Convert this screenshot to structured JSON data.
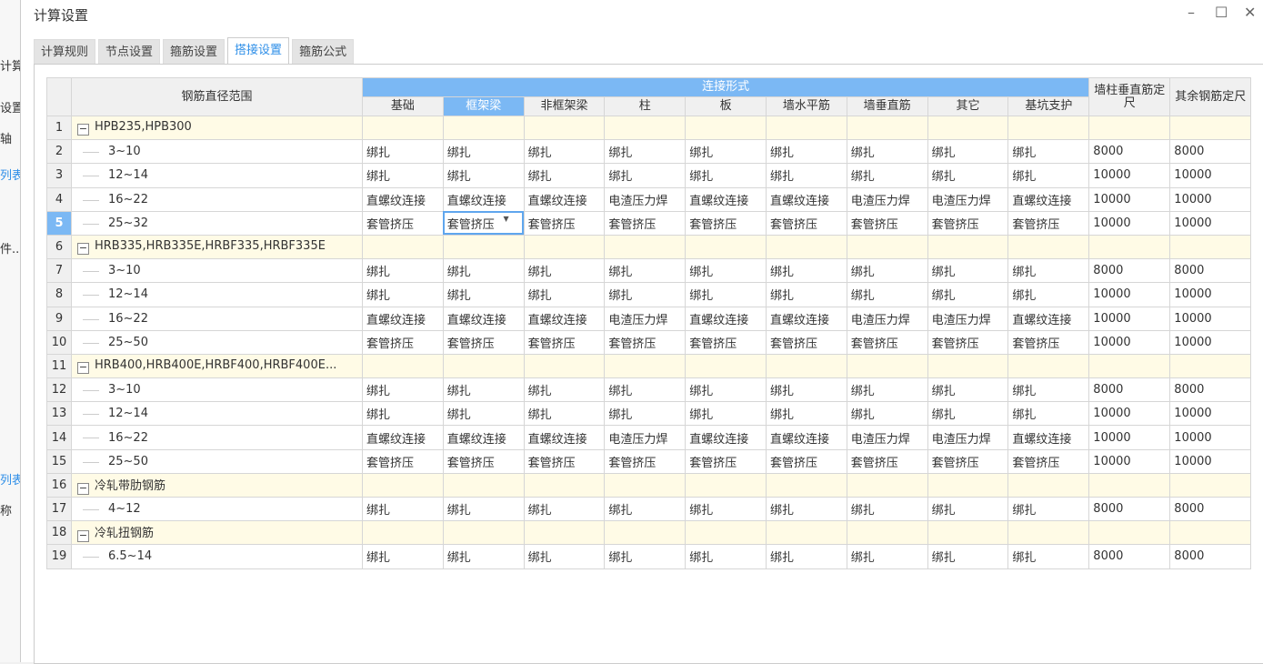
{
  "bg_app": {
    "labels": [
      "计算",
      "设置",
      "轴",
      "列表",
      "件...",
      "列表",
      "称"
    ]
  },
  "window": {
    "title": "计算设置",
    "minimize": "–",
    "maximize": "☐",
    "close": "✕"
  },
  "tabs": [
    {
      "label": "计算规则"
    },
    {
      "label": "节点设置"
    },
    {
      "label": "箍筋设置"
    },
    {
      "label": "搭接设置",
      "active": true
    },
    {
      "label": "箍筋公式"
    }
  ],
  "table": {
    "range_header": "钢筋直径范围",
    "conn_header": "连接形式",
    "conn_columns": [
      "基础",
      "框架梁",
      "非框架梁",
      "柱",
      "板",
      "墙水平筋",
      "墙垂直筋",
      "其它",
      "基坑支护"
    ],
    "len_headers": [
      "墙柱垂直筋定尺",
      "其余钢筋定尺"
    ],
    "selected_column": 1,
    "selected_row": 5,
    "rows": [
      {
        "n": "1",
        "group": true,
        "name": "HPB235,HPB300"
      },
      {
        "n": "2",
        "name": "3~10",
        "v": [
          "绑扎",
          "绑扎",
          "绑扎",
          "绑扎",
          "绑扎",
          "绑扎",
          "绑扎",
          "绑扎",
          "绑扎",
          "8000",
          "8000"
        ]
      },
      {
        "n": "3",
        "name": "12~14",
        "v": [
          "绑扎",
          "绑扎",
          "绑扎",
          "绑扎",
          "绑扎",
          "绑扎",
          "绑扎",
          "绑扎",
          "绑扎",
          "10000",
          "10000"
        ]
      },
      {
        "n": "4",
        "name": "16~22",
        "v": [
          "直螺纹连接",
          "直螺纹连接",
          "直螺纹连接",
          "电渣压力焊",
          "直螺纹连接",
          "直螺纹连接",
          "电渣压力焊",
          "电渣压力焊",
          "直螺纹连接",
          "10000",
          "10000"
        ]
      },
      {
        "n": "5",
        "name": "25~32",
        "v": [
          "套管挤压",
          "套管挤压",
          "套管挤压",
          "套管挤压",
          "套管挤压",
          "套管挤压",
          "套管挤压",
          "套管挤压",
          "套管挤压",
          "10000",
          "10000"
        ]
      },
      {
        "n": "6",
        "group": true,
        "name": "HRB335,HRB335E,HRBF335,HRBF335E"
      },
      {
        "n": "7",
        "name": "3~10",
        "v": [
          "绑扎",
          "绑扎",
          "绑扎",
          "绑扎",
          "绑扎",
          "绑扎",
          "绑扎",
          "绑扎",
          "绑扎",
          "8000",
          "8000"
        ]
      },
      {
        "n": "8",
        "name": "12~14",
        "v": [
          "绑扎",
          "绑扎",
          "绑扎",
          "绑扎",
          "绑扎",
          "绑扎",
          "绑扎",
          "绑扎",
          "绑扎",
          "10000",
          "10000"
        ]
      },
      {
        "n": "9",
        "name": "16~22",
        "v": [
          "直螺纹连接",
          "直螺纹连接",
          "直螺纹连接",
          "电渣压力焊",
          "直螺纹连接",
          "直螺纹连接",
          "电渣压力焊",
          "电渣压力焊",
          "直螺纹连接",
          "10000",
          "10000"
        ]
      },
      {
        "n": "10",
        "name": "25~50",
        "v": [
          "套管挤压",
          "套管挤压",
          "套管挤压",
          "套管挤压",
          "套管挤压",
          "套管挤压",
          "套管挤压",
          "套管挤压",
          "套管挤压",
          "10000",
          "10000"
        ]
      },
      {
        "n": "11",
        "group": true,
        "name": "HRB400,HRB400E,HRBF400,HRBF400E..."
      },
      {
        "n": "12",
        "name": "3~10",
        "v": [
          "绑扎",
          "绑扎",
          "绑扎",
          "绑扎",
          "绑扎",
          "绑扎",
          "绑扎",
          "绑扎",
          "绑扎",
          "8000",
          "8000"
        ]
      },
      {
        "n": "13",
        "name": "12~14",
        "v": [
          "绑扎",
          "绑扎",
          "绑扎",
          "绑扎",
          "绑扎",
          "绑扎",
          "绑扎",
          "绑扎",
          "绑扎",
          "10000",
          "10000"
        ]
      },
      {
        "n": "14",
        "name": "16~22",
        "v": [
          "直螺纹连接",
          "直螺纹连接",
          "直螺纹连接",
          "电渣压力焊",
          "直螺纹连接",
          "直螺纹连接",
          "电渣压力焊",
          "电渣压力焊",
          "直螺纹连接",
          "10000",
          "10000"
        ]
      },
      {
        "n": "15",
        "name": "25~50",
        "v": [
          "套管挤压",
          "套管挤压",
          "套管挤压",
          "套管挤压",
          "套管挤压",
          "套管挤压",
          "套管挤压",
          "套管挤压",
          "套管挤压",
          "10000",
          "10000"
        ]
      },
      {
        "n": "16",
        "group": true,
        "name": "冷轧带肋钢筋"
      },
      {
        "n": "17",
        "name": "4~12",
        "v": [
          "绑扎",
          "绑扎",
          "绑扎",
          "绑扎",
          "绑扎",
          "绑扎",
          "绑扎",
          "绑扎",
          "绑扎",
          "8000",
          "8000"
        ]
      },
      {
        "n": "18",
        "group": true,
        "name": "冷轧扭钢筋"
      },
      {
        "n": "19",
        "name": "6.5~14",
        "v": [
          "绑扎",
          "绑扎",
          "绑扎",
          "绑扎",
          "绑扎",
          "绑扎",
          "绑扎",
          "绑扎",
          "绑扎",
          "8000",
          "8000"
        ]
      }
    ]
  }
}
